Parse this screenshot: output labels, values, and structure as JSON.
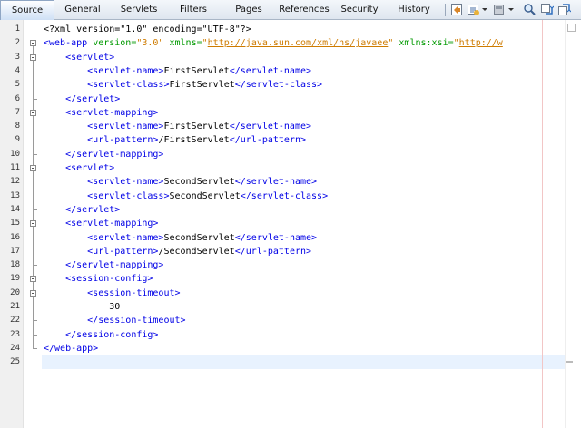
{
  "tabs": [
    {
      "label": "Source",
      "active": true
    },
    {
      "label": "General",
      "active": false
    },
    {
      "label": "Servlets",
      "active": false
    },
    {
      "label": "Filters",
      "active": false
    },
    {
      "label": "Pages",
      "active": false
    },
    {
      "label": "References",
      "active": false
    },
    {
      "label": "Security",
      "active": false
    },
    {
      "label": "History",
      "active": false
    }
  ],
  "toolbar_icons": [
    "back-icon",
    "history-icon",
    "run-icon",
    "find-icon",
    "previous-occurrence-icon",
    "next-occurrence-icon"
  ],
  "colors": {
    "tag": "#0000e6",
    "attribute": "#009900",
    "value": "#ce7b00",
    "current_line": "#e8f2fe",
    "margin_line": "#f2c6c6"
  },
  "current_line": 25,
  "code_lines": [
    [
      {
        "t": "<?xml version=\"1.0\" encoding=\"UTF-8\"?>",
        "c": "plain"
      }
    ],
    [
      {
        "t": "<web-app ",
        "c": "tag"
      },
      {
        "t": "version=",
        "c": "attr"
      },
      {
        "t": "\"3.0\"",
        "c": "val"
      },
      {
        "t": " ",
        "c": "plain"
      },
      {
        "t": "xmlns=",
        "c": "attr"
      },
      {
        "t": "\"",
        "c": "val"
      },
      {
        "t": "http://java.sun.com/xml/ns/javaee",
        "c": "url"
      },
      {
        "t": "\"",
        "c": "val"
      },
      {
        "t": " ",
        "c": "plain"
      },
      {
        "t": "xmlns:xsi=",
        "c": "attr"
      },
      {
        "t": "\"",
        "c": "val"
      },
      {
        "t": "http://w",
        "c": "url"
      }
    ],
    [
      {
        "t": "    <servlet>",
        "c": "tag"
      }
    ],
    [
      {
        "t": "        <servlet-name>",
        "c": "tag"
      },
      {
        "t": "FirstServlet",
        "c": "plain"
      },
      {
        "t": "</servlet-name>",
        "c": "tag"
      }
    ],
    [
      {
        "t": "        <servlet-class>",
        "c": "tag"
      },
      {
        "t": "FirstServlet",
        "c": "plain"
      },
      {
        "t": "</servlet-class>",
        "c": "tag"
      }
    ],
    [
      {
        "t": "    </servlet>",
        "c": "tag"
      }
    ],
    [
      {
        "t": "    <servlet-mapping>",
        "c": "tag"
      }
    ],
    [
      {
        "t": "        <servlet-name>",
        "c": "tag"
      },
      {
        "t": "FirstServlet",
        "c": "plain"
      },
      {
        "t": "</servlet-name>",
        "c": "tag"
      }
    ],
    [
      {
        "t": "        <url-pattern>",
        "c": "tag"
      },
      {
        "t": "/FirstServlet",
        "c": "plain"
      },
      {
        "t": "</url-pattern>",
        "c": "tag"
      }
    ],
    [
      {
        "t": "    </servlet-mapping>",
        "c": "tag"
      }
    ],
    [
      {
        "t": "    <servlet>",
        "c": "tag"
      }
    ],
    [
      {
        "t": "        <servlet-name>",
        "c": "tag"
      },
      {
        "t": "SecondServlet",
        "c": "plain"
      },
      {
        "t": "</servlet-name>",
        "c": "tag"
      }
    ],
    [
      {
        "t": "        <servlet-class>",
        "c": "tag"
      },
      {
        "t": "SecondServlet",
        "c": "plain"
      },
      {
        "t": "</servlet-class>",
        "c": "tag"
      }
    ],
    [
      {
        "t": "    </servlet>",
        "c": "tag"
      }
    ],
    [
      {
        "t": "    <servlet-mapping>",
        "c": "tag"
      }
    ],
    [
      {
        "t": "        <servlet-name>",
        "c": "tag"
      },
      {
        "t": "SecondServlet",
        "c": "plain"
      },
      {
        "t": "</servlet-name>",
        "c": "tag"
      }
    ],
    [
      {
        "t": "        <url-pattern>",
        "c": "tag"
      },
      {
        "t": "/SecondServlet",
        "c": "plain"
      },
      {
        "t": "</url-pattern>",
        "c": "tag"
      }
    ],
    [
      {
        "t": "    </servlet-mapping>",
        "c": "tag"
      }
    ],
    [
      {
        "t": "    <session-config>",
        "c": "tag"
      }
    ],
    [
      {
        "t": "        <session-timeout>",
        "c": "tag"
      }
    ],
    [
      {
        "t": "            30",
        "c": "plain"
      }
    ],
    [
      {
        "t": "        </session-timeout>",
        "c": "tag"
      }
    ],
    [
      {
        "t": "    </session-config>",
        "c": "tag"
      }
    ],
    [
      {
        "t": "</web-app>",
        "c": "tag"
      }
    ],
    [
      {
        "t": "",
        "c": "plain"
      }
    ]
  ]
}
